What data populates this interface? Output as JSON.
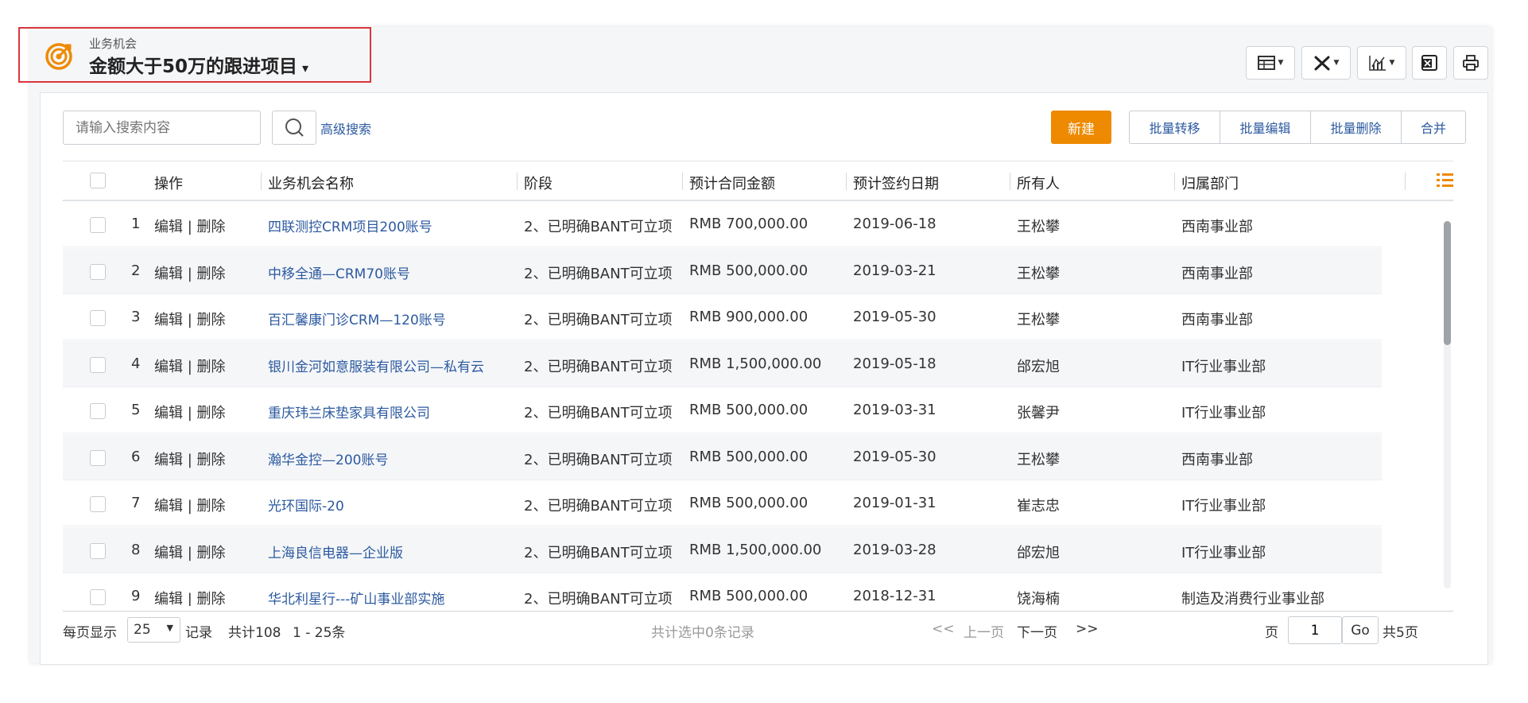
{
  "header": {
    "subtitle": "业务机会",
    "title": "金额大于50万的跟进项目",
    "title_caret": "▾",
    "accent_color": "#ee8a00",
    "toolbar_icons": [
      "table-view-icon",
      "tools-icon",
      "chart-icon",
      "excel-export-icon",
      "print-icon"
    ]
  },
  "search": {
    "placeholder": "请输入搜索内容",
    "advanced_label": "高级搜索"
  },
  "actions": {
    "new_label": "新建",
    "batch": [
      "批量转移",
      "批量编辑",
      "批量删除",
      "合并"
    ]
  },
  "table": {
    "columns": [
      "操作",
      "业务机会名称",
      "阶段",
      "预计合同金额",
      "预计签约日期",
      "所有人",
      "归属部门"
    ],
    "op_label": "编辑 | 删除",
    "rows": [
      {
        "idx": "1",
        "name": "四联测控CRM项目200账号",
        "stage": "2、已明确BANT可立项",
        "amount": "RMB 700,000.00",
        "date": "2019-06-18",
        "owner": "王松攀",
        "dept": "西南事业部"
      },
      {
        "idx": "2",
        "name": "中移全通—CRM70账号",
        "stage": "2、已明确BANT可立项",
        "amount": "RMB 500,000.00",
        "date": "2019-03-21",
        "owner": "王松攀",
        "dept": "西南事业部"
      },
      {
        "idx": "3",
        "name": "百汇馨康门诊CRM—120账号",
        "stage": "2、已明确BANT可立项",
        "amount": "RMB 900,000.00",
        "date": "2019-05-30",
        "owner": "王松攀",
        "dept": "西南事业部"
      },
      {
        "idx": "4",
        "name": "银川金河如意服装有限公司—私有云",
        "stage": "2、已明确BANT可立项",
        "amount": "RMB 1,500,000.00",
        "date": "2019-05-18",
        "owner": "邰宏旭",
        "dept": "IT行业事业部"
      },
      {
        "idx": "5",
        "name": "重庆玮兰床垫家具有限公司",
        "stage": "2、已明确BANT可立项",
        "amount": "RMB 500,000.00",
        "date": "2019-03-31",
        "owner": "张馨尹",
        "dept": "IT行业事业部"
      },
      {
        "idx": "6",
        "name": "瀚华金控—200账号",
        "stage": "2、已明确BANT可立项",
        "amount": "RMB 500,000.00",
        "date": "2019-05-30",
        "owner": "王松攀",
        "dept": "西南事业部"
      },
      {
        "idx": "7",
        "name": "光环国际-20",
        "stage": "2、已明确BANT可立项",
        "amount": "RMB 500,000.00",
        "date": "2019-01-31",
        "owner": "崔志忠",
        "dept": "IT行业事业部"
      },
      {
        "idx": "8",
        "name": "上海良信电器—企业版",
        "stage": "2、已明确BANT可立项",
        "amount": "RMB 1,500,000.00",
        "date": "2019-03-28",
        "owner": "邰宏旭",
        "dept": "IT行业事业部"
      },
      {
        "idx": "9",
        "name": "华北利星行---矿山事业部实施",
        "stage": "2、已明确BANT可立项",
        "amount": "RMB 500,000.00",
        "date": "2018-12-31",
        "owner": "饶海楠",
        "dept": "制造及消费行业事业部"
      }
    ]
  },
  "pager": {
    "per_page_label": "每页显示",
    "per_page_value": "25",
    "records_label": "记录",
    "total_label": "共计108",
    "range_label": "1 - 25条",
    "selected_label": "共计选中0条记录",
    "first": "<<",
    "prev": "上一页",
    "next": "下一页",
    "last": ">>",
    "page_label": "页",
    "page_value": "1",
    "go_label": "Go",
    "total_pages": "共5页"
  }
}
